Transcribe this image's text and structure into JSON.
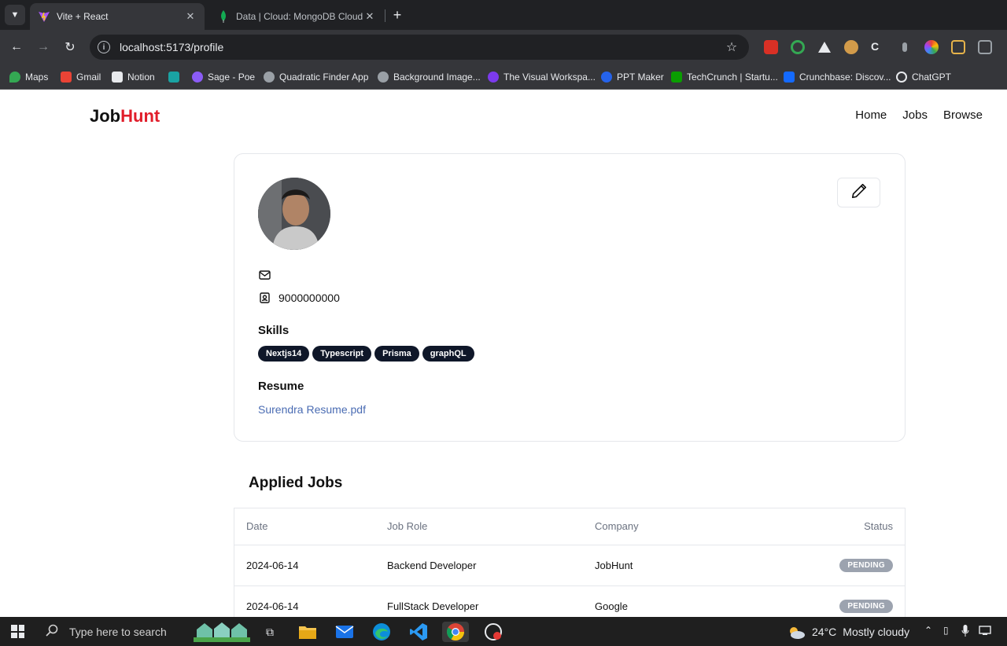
{
  "browser": {
    "tabs": [
      {
        "title": "Vite + React",
        "active": true
      },
      {
        "title": "Data | Cloud: MongoDB Cloud",
        "active": false
      }
    ],
    "url": "localhost:5173/profile",
    "bookmarks": [
      {
        "label": "Maps",
        "color": "#34a853"
      },
      {
        "label": "Gmail",
        "color": "#ea4335"
      },
      {
        "label": "Notion",
        "color": "#e8eaed"
      },
      {
        "label": "",
        "color": "#1aa3a3"
      },
      {
        "label": "Sage - Poe",
        "color": "#8b5cf6"
      },
      {
        "label": "Quadratic Finder App",
        "color": "#9aa0a6"
      },
      {
        "label": "Background Image...",
        "color": "#9aa0a6"
      },
      {
        "label": "The Visual Workspa...",
        "color": "#7c3aed"
      },
      {
        "label": "PPT Maker",
        "color": "#2563eb"
      },
      {
        "label": "TechCrunch | Startu...",
        "color": "#0a9e01"
      },
      {
        "label": "Crunchbase: Discov...",
        "color": "#146aff"
      },
      {
        "label": "ChatGPT",
        "color": "#e8eaed"
      }
    ]
  },
  "header": {
    "logo_part1": "Job",
    "logo_part2": "Hunt",
    "nav": [
      "Home",
      "Jobs",
      "Browse"
    ]
  },
  "profile": {
    "phone": "9000000000",
    "skills_label": "Skills",
    "skills": [
      "Nextjs14",
      "Typescript",
      "Prisma",
      "graphQL"
    ],
    "resume_label": "Resume",
    "resume_file": "Surendra Resume.pdf"
  },
  "applied": {
    "title": "Applied Jobs",
    "columns": [
      "Date",
      "Job Role",
      "Company",
      "Status"
    ],
    "rows": [
      {
        "date": "2024-06-14",
        "role": "Backend Developer",
        "company": "JobHunt",
        "status": "PENDING"
      },
      {
        "date": "2024-06-14",
        "role": "FullStack Developer",
        "company": "Google",
        "status": "PENDING"
      }
    ]
  },
  "taskbar": {
    "search_placeholder": "Type here to search",
    "temperature": "24°C",
    "weather": "Mostly cloudy"
  }
}
